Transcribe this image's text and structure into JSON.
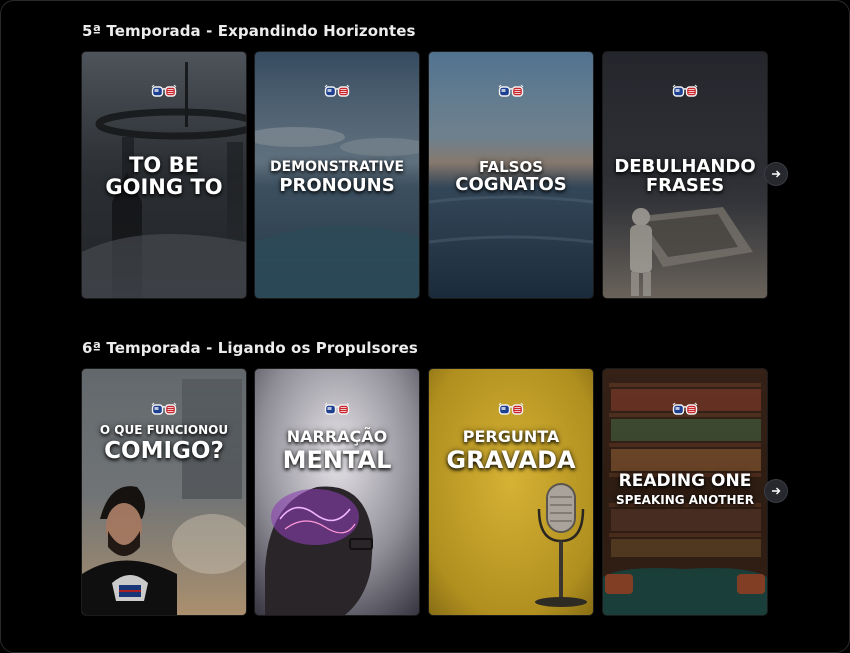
{
  "sections": [
    {
      "title": "5ª Temporada - Expandindo Horizontes",
      "cards": [
        {
          "line1": "TO BE",
          "line2": "GOING TO"
        },
        {
          "line1": "DEMONSTRATIVE",
          "line2": "PRONOUNS"
        },
        {
          "line1": "FALSOS",
          "line2": "COGNATOS"
        },
        {
          "line1": "DEBULHANDO",
          "line2": "FRASES"
        }
      ],
      "next_icon": "arrow-right-icon"
    },
    {
      "title": "6ª Temporada - Ligando os Propulsores",
      "cards": [
        {
          "line1": "O QUE FUNCIONOU",
          "line2": "COMIGO?"
        },
        {
          "line1": "NARRAÇÃO",
          "line2": "MENTAL"
        },
        {
          "line1": "PERGUNTA",
          "line2": "GRAVADA"
        },
        {
          "line1": "READING ONE",
          "line2": "SPEAKING ANOTHER"
        }
      ],
      "next_icon": "arrow-right-icon"
    }
  ],
  "colors": {
    "background": "#000000",
    "section_title": "#ececec",
    "arrow_bg": "#26282e"
  }
}
